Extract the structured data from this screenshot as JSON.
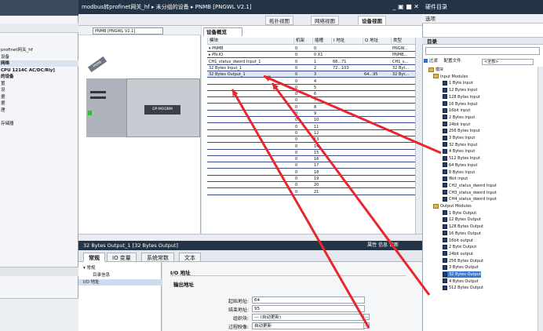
{
  "left_tree": {
    "items": [
      {
        "label": "profinet网关_hf",
        "bold": false,
        "sel": false
      },
      {
        "label": "设备",
        "bold": false,
        "sel": false
      },
      {
        "label": "网络",
        "bold": true,
        "sel": true
      },
      {
        "label": "CPU 1214C AC/DC/Rly]",
        "bold": true,
        "sel": false
      },
      {
        "label": "的设备",
        "bold": true,
        "sel": false
      },
      {
        "label": "置",
        "bold": false,
        "sel": false
      },
      {
        "label": "设",
        "bold": false,
        "sel": false
      },
      {
        "label": "据",
        "bold": false,
        "sel": false
      },
      {
        "label": "据",
        "bold": false,
        "sel": false
      },
      {
        "label": "理",
        "bold": false,
        "sel": false
      },
      {
        "label": "",
        "bold": false,
        "sel": false
      },
      {
        "label": "存储器",
        "bold": false,
        "sel": false
      }
    ]
  },
  "editor": {
    "title": "modbus转profinet网关_hf ▸ 未分组的设备 ▸ PNMB [PNGWL V2.1]",
    "window_controls": "_ ▣ ■ ✕",
    "views": [
      "拓扑视图",
      "网络视图",
      "设备视图"
    ],
    "active_view": "设备视图",
    "device_selector": "PNMB [PNGWL V2.1]",
    "device_tag": "PNMB",
    "module_label": "DP-MODBM"
  },
  "overview": {
    "tab_label": "设备概览",
    "columns": [
      "模块",
      "机架",
      "插槽",
      "I 地址",
      "Q 地址",
      "类型"
    ],
    "rows": [
      {
        "module": "▾ PNMB",
        "rack": "0",
        "slot": "0",
        "i": "",
        "q": "",
        "type": "PNGW...",
        "hl": false
      },
      {
        "module": "  ▸ PN-IO",
        "rack": "0",
        "slot": "0 X1",
        "i": "",
        "q": "",
        "type": "PNMB...",
        "hl": false
      },
      {
        "module": "  CH1_status_dword Input_1",
        "rack": "0",
        "slot": "1",
        "i": "68...71",
        "q": "",
        "type": "CH1_s...",
        "hl": false
      },
      {
        "module": "  32 Bytes Input_1",
        "rack": "0",
        "slot": "2",
        "i": "72...103",
        "q": "",
        "type": "32 Byt...",
        "hl": false
      },
      {
        "module": "  32 Bytes Output_1",
        "rack": "0",
        "slot": "3",
        "i": "",
        "q": "64...95",
        "type": "32 Byt...",
        "hl": true
      },
      {
        "module": "",
        "rack": "0",
        "slot": "4",
        "i": "",
        "q": "",
        "type": "",
        "hl": false
      },
      {
        "module": "",
        "rack": "0",
        "slot": "5",
        "i": "",
        "q": "",
        "type": "",
        "hl": false
      },
      {
        "module": "",
        "rack": "0",
        "slot": "6",
        "i": "",
        "q": "",
        "type": "",
        "hl": false
      },
      {
        "module": "",
        "rack": "0",
        "slot": "7",
        "i": "",
        "q": "",
        "type": "",
        "hl": false
      },
      {
        "module": "",
        "rack": "0",
        "slot": "8",
        "i": "",
        "q": "",
        "type": "",
        "hl": false
      },
      {
        "module": "",
        "rack": "0",
        "slot": "9",
        "i": "",
        "q": "",
        "type": "",
        "hl": false
      },
      {
        "module": "",
        "rack": "0",
        "slot": "10",
        "i": "",
        "q": "",
        "type": "",
        "hl": false
      },
      {
        "module": "",
        "rack": "0",
        "slot": "11",
        "i": "",
        "q": "",
        "type": "",
        "hl": false
      },
      {
        "module": "",
        "rack": "0",
        "slot": "12",
        "i": "",
        "q": "",
        "type": "",
        "hl": false
      },
      {
        "module": "",
        "rack": "0",
        "slot": "13",
        "i": "",
        "q": "",
        "type": "",
        "hl": false
      },
      {
        "module": "",
        "rack": "0",
        "slot": "14",
        "i": "",
        "q": "",
        "type": "",
        "hl": false
      },
      {
        "module": "",
        "rack": "0",
        "slot": "15",
        "i": "",
        "q": "",
        "type": "",
        "hl": false
      },
      {
        "module": "",
        "rack": "0",
        "slot": "16",
        "i": "",
        "q": "",
        "type": "",
        "hl": false
      },
      {
        "module": "",
        "rack": "0",
        "slot": "17",
        "i": "",
        "q": "",
        "type": "",
        "hl": false
      },
      {
        "module": "",
        "rack": "0",
        "slot": "18",
        "i": "",
        "q": "",
        "type": "",
        "hl": false
      },
      {
        "module": "",
        "rack": "0",
        "slot": "19",
        "i": "",
        "q": "",
        "type": "",
        "hl": false
      },
      {
        "module": "",
        "rack": "0",
        "slot": "20",
        "i": "",
        "q": "",
        "type": "",
        "hl": false
      },
      {
        "module": "",
        "rack": "0",
        "slot": "21",
        "i": "",
        "q": "",
        "type": "",
        "hl": false
      }
    ]
  },
  "properties": {
    "title": "32 Bytes Output_1 [32 Bytes Output]",
    "right_tabs": "属性  信息  诊断",
    "tabs": [
      "常规",
      "IO 变量",
      "系统常数",
      "文本"
    ],
    "active_tab": "常规",
    "nav": [
      {
        "label": "▾ 常规",
        "indent": false,
        "sel": false
      },
      {
        "label": "目录信息",
        "indent": true,
        "sel": false
      },
      {
        "label": "I/O 地址",
        "indent": false,
        "sel": true
      }
    ],
    "section_title": "I/O 地址",
    "group_title": "输出地址",
    "fields": [
      {
        "label": "起始地址:",
        "value": "64"
      },
      {
        "label": "结束地址:",
        "value": "95"
      },
      {
        "label": "组织块:",
        "value": "--- (自动更新)"
      },
      {
        "label": "过程映像:",
        "value": "自动更新"
      }
    ]
  },
  "catalog": {
    "title": "硬件目录",
    "options_label": "选项",
    "section": "目录",
    "filter_label": "过滤",
    "profile_label": "配置文件",
    "profile_value": "<全部>",
    "root": "模块",
    "input_folder": "Input Modules",
    "inputs": [
      "1 Byte Input",
      "12 Bytes Input",
      "128 Bytes Input",
      "16 Bytes Input",
      "16bit input",
      "2 Bytes Input",
      "24bit input",
      "256 Bytes Input",
      "3 Bytes Input",
      "32 Bytes Input",
      "4 Bytes Input",
      "512 Bytes Input",
      "64 Bytes Input",
      "8 Bytes Input",
      "8bit input",
      "CH2_status_dword Input",
      "CH3_status_dword Input",
      "CH4_status_dword Input"
    ],
    "output_folder": "Output Modules",
    "outputs": [
      "1 Byte Output",
      "12 Bytes Output",
      "128 Bytes Output",
      "16 Bytes Output",
      "16bit output",
      "2 Byte Output",
      "24bit output",
      "256 Bytes Output",
      "3 Bytes Output",
      "32 Bytes Output",
      "4 Bytes Output",
      "512 Bytes Output"
    ],
    "selected_output": "32 Bytes Output",
    "colors": {
      "selection": "#3a78d6",
      "arrow": "#e8262b"
    }
  }
}
